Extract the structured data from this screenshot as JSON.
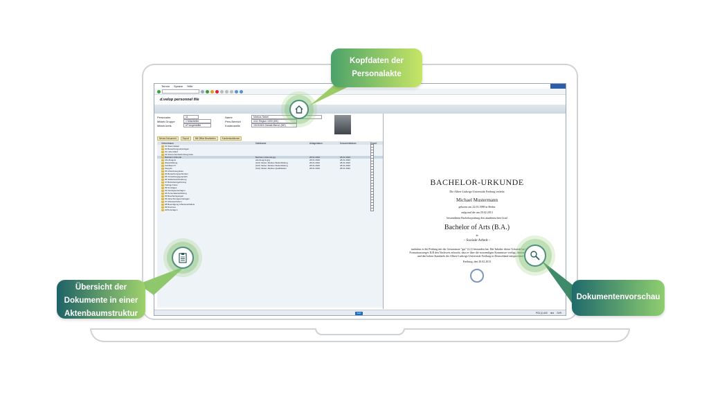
{
  "app": {
    "menu": [
      "Termin",
      "System",
      "Hilfe"
    ],
    "title": "d.velop personnel file"
  },
  "header_fields": [
    {
      "label": "Personalnr",
      "value": "11"
    },
    {
      "label": "Mitarb.Gruppe",
      "value": "1  Mitarbeiter"
    },
    {
      "label": "Mitarb.kreis",
      "value": "AT  Angestellte"
    },
    {
      "label": "Name",
      "value": "Markus Sinkel"
    },
    {
      "label": "Pers.Bereich",
      "value": "1111  Region 1000 (DE)"
    },
    {
      "label": "Kostenstelle",
      "value": "10101501  Dienstl./Beruf. (DE)"
    }
  ],
  "doc_toolbar": [
    "Neues Dokument",
    "Export",
    "Mit Office Bearbeiten",
    "Kundenfunktionen"
  ],
  "grid": {
    "columns": [
      "Ordnerbaum",
      "Dateiname",
      "Anlagedatum",
      "Dokumentdatum",
      "Export"
    ],
    "rows": [
      {
        "tree": "01 Stammdaten",
        "file": "",
        "d1": "",
        "d2": ""
      },
      {
        "tree": "02 Bewerbungsunterlagen",
        "file": "",
        "d1": "",
        "d2": ""
      },
      {
        "tree": "01 Lebenslauf",
        "file": "",
        "d1": "",
        "d2": ""
      },
      {
        "tree": "02 Schul-/Hochschulzeugnisse",
        "file": "",
        "d1": "",
        "d2": ""
      },
      {
        "tree": "Bachelor-Urkunde",
        "file": "Bachelor-Urkunde.jpg",
        "d1": "28.01.2020",
        "d2": "28.01.2020",
        "selected": true
      },
      {
        "tree": "Abi-Zeugnis",
        "file": "Abi-Zeugnis.jpg",
        "d1": "28.01.2020",
        "d2": "28.01.2020"
      },
      {
        "tree": "Weiterbildung",
        "file": "(102) Sinkel, Markus Weiterbildung",
        "d1": "28.01.2020",
        "d2": "28.01.2020"
      },
      {
        "tree": "Zertifikat XY",
        "file": "(102) Sinkel, Markus Weiterbildung",
        "d1": "28.01.2020",
        "d2": "28.01.2020"
      },
      {
        "tree": "Zeugnis",
        "file": "(102) Sinkel, Markus Qualifikation",
        "d1": "28.01.2020",
        "d2": "28.01.2020"
      },
      {
        "tree": "03 Arbeitszeugnisse",
        "file": "",
        "d1": "",
        "d2": ""
      },
      {
        "tree": "04 Bewerbungsschreiben",
        "file": "",
        "d1": "",
        "d2": ""
      },
      {
        "tree": "05 Vorstellungsgespräch",
        "file": "",
        "d1": "",
        "d2": ""
      },
      {
        "tree": "06 Stellenbeschreibung",
        "file": "",
        "d1": "",
        "d2": ""
      },
      {
        "tree": "07 Betriebszugehörung",
        "file": "",
        "d1": "",
        "d2": ""
      },
      {
        "tree": "Farbige Fotos",
        "file": "",
        "d1": "",
        "d2": ""
      },
      {
        "tree": "99 Sonstiges",
        "file": "",
        "d1": "",
        "d2": ""
      },
      {
        "tree": "03 Vertragsunterlagen",
        "file": "",
        "d1": "",
        "d2": ""
      },
      {
        "tree": "04 Personalentwicklung",
        "file": "",
        "d1": "",
        "d2": ""
      },
      {
        "tree": "05 Bescheinigungen",
        "file": "",
        "d1": "",
        "d2": ""
      },
      {
        "tree": "06 Abrechnungsunterlagen",
        "file": "",
        "d1": "",
        "d2": ""
      },
      {
        "tree": "07 Abwesenheiten",
        "file": "",
        "d1": "",
        "d2": ""
      },
      {
        "tree": "08 Beendigung Arbeitsverhältnis",
        "file": "",
        "d1": "",
        "d2": ""
      },
      {
        "tree": "09 Diverses",
        "file": "",
        "d1": "",
        "d2": ""
      },
      {
        "tree": "GDS-Anlagen",
        "file": "",
        "d1": "",
        "d2": ""
      }
    ]
  },
  "document": {
    "title": "BACHELOR-URKUNDE",
    "line1": "Die Albert-Ludwigs-Universität Freiburg verleiht",
    "name": "Michael Mustermann",
    "line2": "geboren am 22.03.1988 in Berlin",
    "line3": "aufgrund der am 20.02.2013",
    "line4": "bestandenen Bachelorprüfung den akademischen Grad",
    "degree": "Bachelor of Arts (B.A.)",
    "in": "in",
    "subject": "- Soziale Arbeit -",
    "body": "nachdem er die Prüfung mit der Gesamtnote \"gut\" (2,2) bestanden hat. Der Inhaber dieser Urkunde hat im Rahmen des Formationsweges ILB den Nachweis erbracht, dass er über die notwendigen Kenntnisse verfügt, diesen Beruf fachgerecht und den hohen Standards der Albert-Ludwigs-Universität Freiburg in Deutschland entsprechend auszuüben.",
    "date": "Freiburg, den 20.02.2013"
  },
  "status": {
    "sap": "SAP",
    "items": [
      "P03 (1) 400",
      "nhd",
      "OVR"
    ]
  },
  "callouts": {
    "top": "Kopfdaten der Personalakte",
    "left": "Übersicht der Dokumente in einer Aktenbaumstruktur",
    "right": "Dokumentenvorschau"
  },
  "colors": {
    "callout_dark": "#1e6267",
    "callout_light": "#c7e565",
    "sap_blue": "#1e6dc2"
  }
}
